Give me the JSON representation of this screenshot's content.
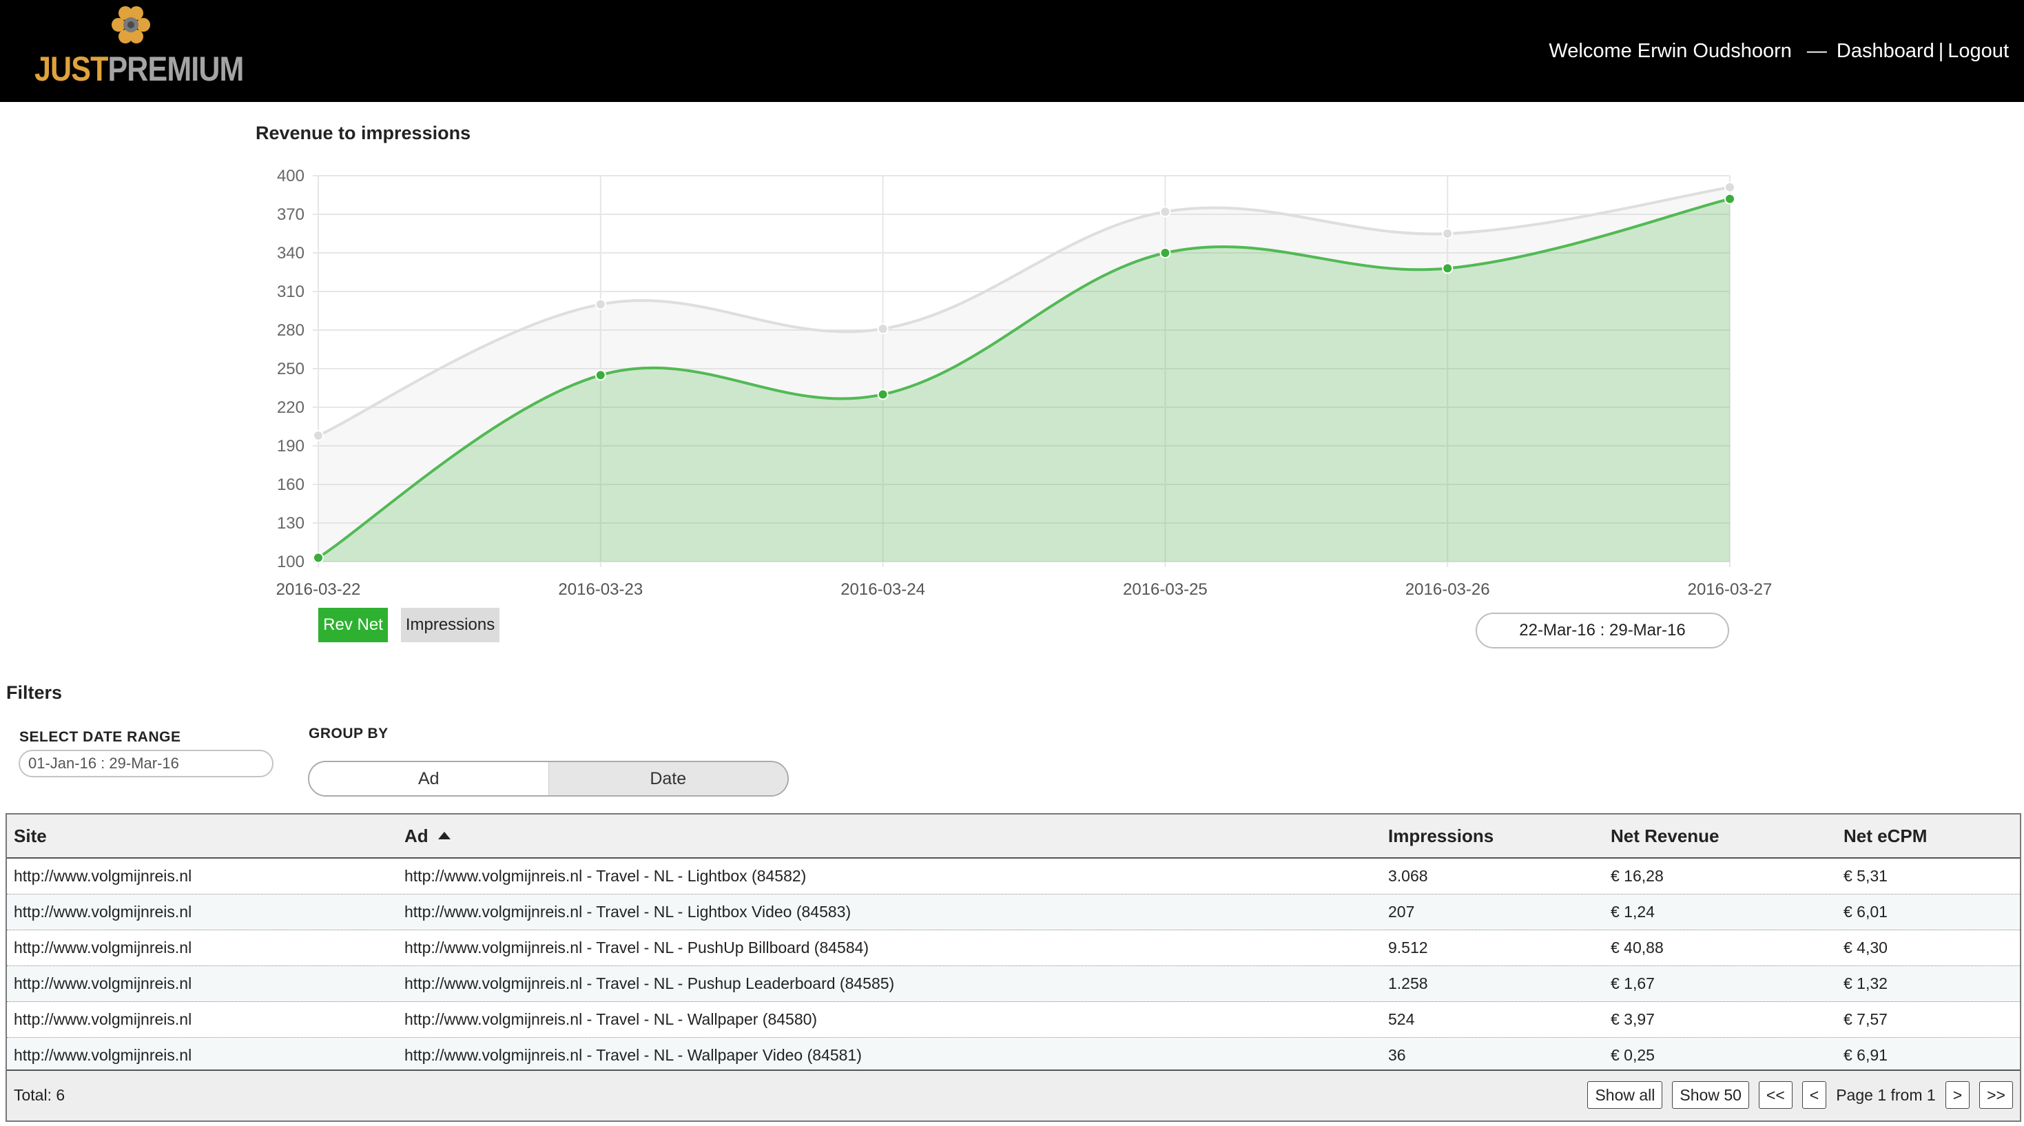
{
  "header": {
    "logo_part1": "JUST",
    "logo_part2": "PREMIUM",
    "welcome": "Welcome Erwin Oudshoorn",
    "separator": "—",
    "dashboard_link": "Dashboard",
    "pipe": "|",
    "logout_link": "Logout"
  },
  "chart_section": {
    "title": "Revenue to impressions",
    "legend_rev": "Rev Net",
    "legend_imp": "Impressions",
    "date_range": "22-Mar-16 : 29-Mar-16"
  },
  "chart_data": {
    "type": "area",
    "x": [
      "2016-03-22",
      "2016-03-23",
      "2016-03-24",
      "2016-03-25",
      "2016-03-26",
      "2016-03-27"
    ],
    "series": [
      {
        "name": "Impressions",
        "values": [
          198,
          300,
          281,
          372,
          355,
          391
        ],
        "color": "#dcdcdc"
      },
      {
        "name": "Rev Net",
        "values": [
          103,
          245,
          230,
          340,
          328,
          382
        ],
        "color": "#46b548"
      }
    ],
    "ylim": [
      100,
      400
    ],
    "yticks": [
      100,
      130,
      160,
      190,
      220,
      250,
      280,
      310,
      340,
      370,
      400
    ],
    "grid": true
  },
  "filters": {
    "title": "Filters",
    "date_label": "SELECT DATE RANGE",
    "date_value": "01-Jan-16 : 29-Mar-16",
    "group_label": "GROUP BY",
    "group_options": [
      "Ad",
      "Date"
    ],
    "group_selected": "Ad"
  },
  "table": {
    "columns": [
      "Site",
      "Ad",
      "Impressions",
      "Net Revenue",
      "Net eCPM"
    ],
    "sorted_column": "Ad",
    "rows": [
      [
        "http://www.volgmijnreis.nl",
        "http://www.volgmijnreis.nl - Travel - NL - Lightbox (84582)",
        "3.068",
        "€ 16,28",
        "€ 5,31"
      ],
      [
        "http://www.volgmijnreis.nl",
        "http://www.volgmijnreis.nl - Travel - NL - Lightbox Video (84583)",
        "207",
        "€ 1,24",
        "€ 6,01"
      ],
      [
        "http://www.volgmijnreis.nl",
        "http://www.volgmijnreis.nl - Travel - NL - PushUp Billboard (84584)",
        "9.512",
        "€ 40,88",
        "€ 4,30"
      ],
      [
        "http://www.volgmijnreis.nl",
        "http://www.volgmijnreis.nl - Travel - NL - Pushup Leaderboard (84585)",
        "1.258",
        "€ 1,67",
        "€ 1,32"
      ],
      [
        "http://www.volgmijnreis.nl",
        "http://www.volgmijnreis.nl - Travel - NL - Wallpaper (84580)",
        "524",
        "€ 3,97",
        "€ 7,57"
      ],
      [
        "http://www.volgmijnreis.nl",
        "http://www.volgmijnreis.nl - Travel - NL - Wallpaper Video (84581)",
        "36",
        "€ 0,25",
        "€ 6,91"
      ]
    ],
    "total": "Total: 6",
    "pager": {
      "show_all": "Show all",
      "show_50": "Show 50",
      "first": "<<",
      "prev": "<",
      "page_info": "Page 1 from 1",
      "next": ">",
      "last": ">>"
    }
  }
}
